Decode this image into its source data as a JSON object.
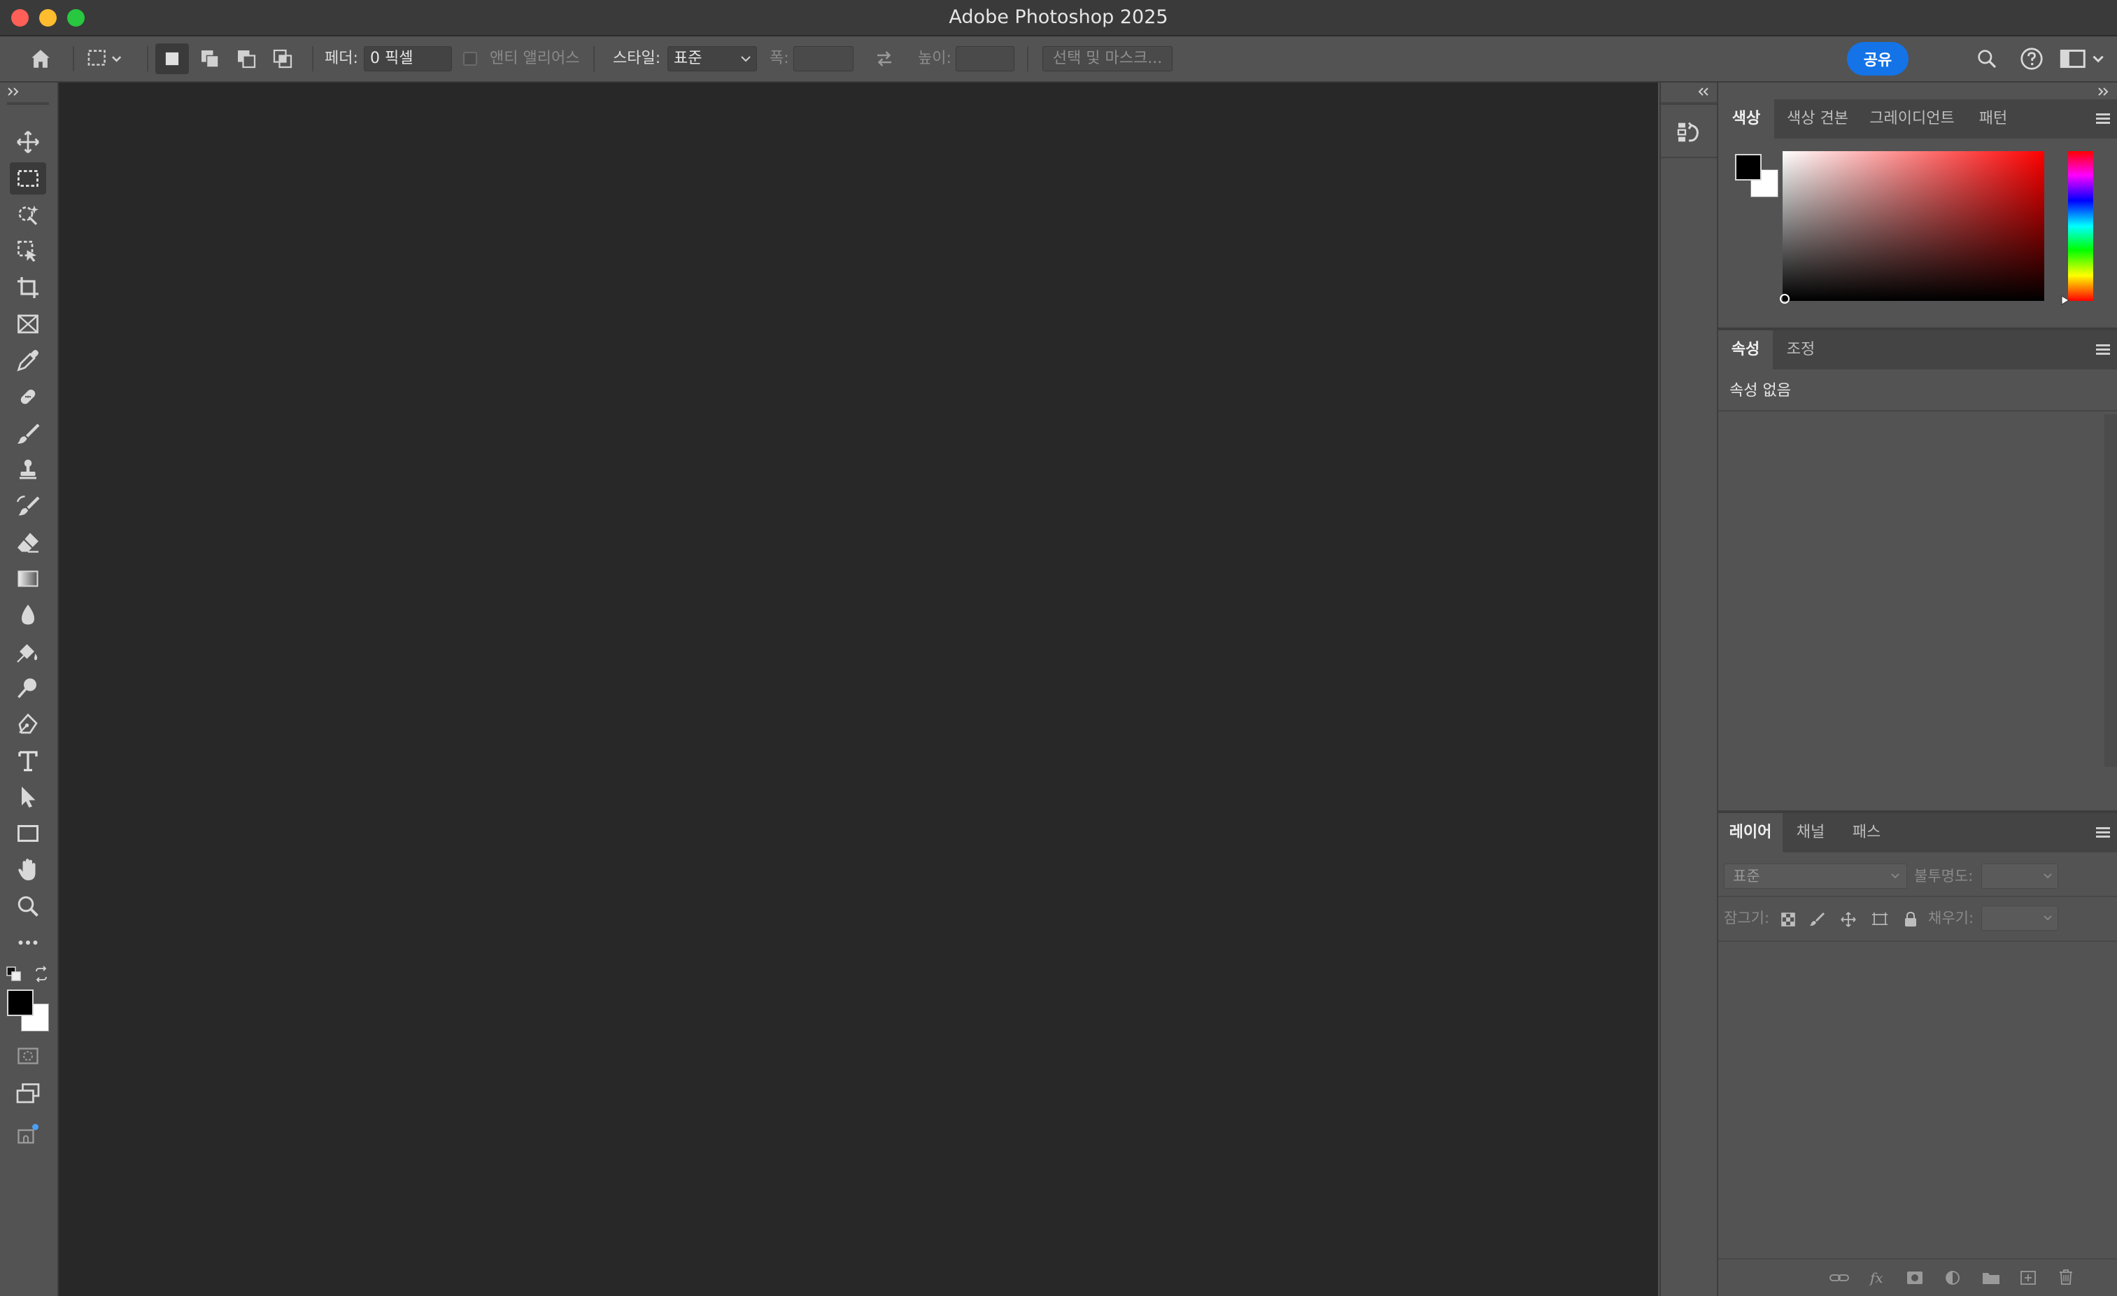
{
  "window": {
    "title": "Adobe Photoshop 2025"
  },
  "options_bar": {
    "feather_label": "페더:",
    "feather_value": "0 픽셀",
    "anti_alias_label": "앤티 앨리어스",
    "style_label": "스타일:",
    "style_value": "표준",
    "width_label": "폭:",
    "height_label": "높이:",
    "select_mask_label": "선택 및 마스크...",
    "share_label": "공유"
  },
  "color_panel": {
    "tabs": [
      "색상",
      "색상 견본",
      "그레이디언트",
      "패턴"
    ],
    "active_tab": 0,
    "foreground": "#000000",
    "background": "#ffffff",
    "hue_color": "#ff0000"
  },
  "properties_panel": {
    "tabs": [
      "속성",
      "조정"
    ],
    "active_tab": 0,
    "empty_text": "속성 없음"
  },
  "layers_panel": {
    "tabs": [
      "레이어",
      "채널",
      "패스"
    ],
    "active_tab": 0,
    "blend_mode": "표준",
    "opacity_label": "불투명도:",
    "lock_label": "잠그기:",
    "fill_label": "채우기:"
  },
  "colors": {
    "accent": "#1473e6",
    "canvas": "#282828",
    "panel": "#535353"
  }
}
